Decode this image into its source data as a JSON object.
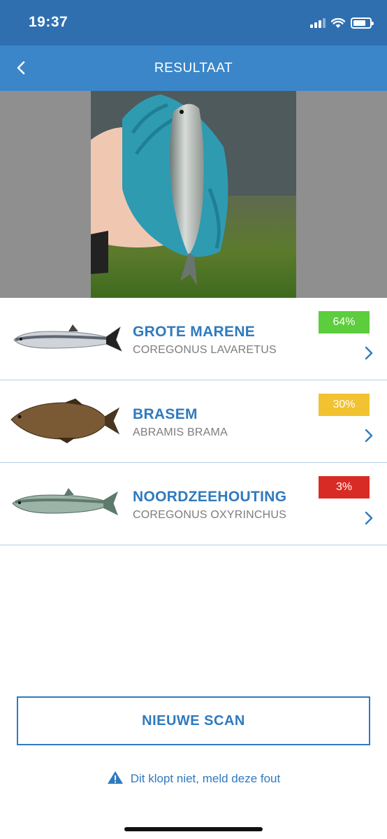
{
  "status": {
    "time": "19:37",
    "battery_level": 0.75
  },
  "nav": {
    "title": "RESULTAAT",
    "back_icon": "chevron-left-icon"
  },
  "results": [
    {
      "name": "GROTE MARENE",
      "latin": "COREGONUS LAVARETUS",
      "percent": "64%",
      "color": "#5ccd3c"
    },
    {
      "name": "BRASEM",
      "latin": "ABRAMIS BRAMA",
      "percent": "30%",
      "color": "#f2c230"
    },
    {
      "name": "NOORDZEEHOUTING",
      "latin": "COREGONUS OXYRINCHUS",
      "percent": "3%",
      "color": "#d92b25"
    }
  ],
  "actions": {
    "new_scan": "NIEUWE SCAN",
    "report_error": "Dit klopt niet, meld deze fout"
  }
}
